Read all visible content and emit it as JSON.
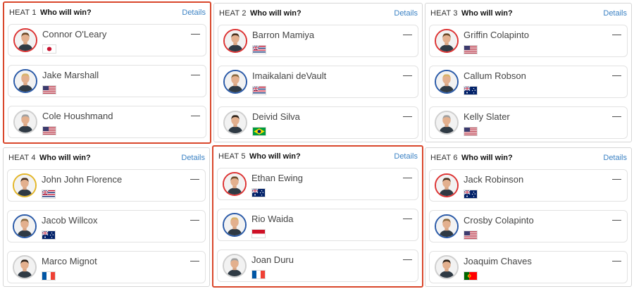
{
  "question_label": "Who will win?",
  "details_label": "Details",
  "odds_placeholder": "—",
  "heats": [
    {
      "label": "HEAT 1",
      "highlighted": true,
      "surfers": [
        {
          "name": "Connor O'Leary",
          "flag": "japan",
          "ring": "red"
        },
        {
          "name": "Jake Marshall",
          "flag": "usa",
          "ring": "blue"
        },
        {
          "name": "Cole Houshmand",
          "flag": "usa",
          "ring": "gray"
        }
      ]
    },
    {
      "label": "HEAT 2",
      "highlighted": false,
      "surfers": [
        {
          "name": "Barron Mamiya",
          "flag": "hawaii",
          "ring": "red"
        },
        {
          "name": "Imaikalani deVault",
          "flag": "hawaii",
          "ring": "blue"
        },
        {
          "name": "Deivid Silva",
          "flag": "brazil",
          "ring": "gray"
        }
      ]
    },
    {
      "label": "HEAT 3",
      "highlighted": false,
      "surfers": [
        {
          "name": "Griffin Colapinto",
          "flag": "usa",
          "ring": "red"
        },
        {
          "name": "Callum Robson",
          "flag": "australia",
          "ring": "blue"
        },
        {
          "name": "Kelly Slater",
          "flag": "usa",
          "ring": "gray"
        }
      ]
    },
    {
      "label": "HEAT 4",
      "highlighted": false,
      "surfers": [
        {
          "name": "John John Florence",
          "flag": "hawaii",
          "ring": "yellow"
        },
        {
          "name": "Jacob Willcox",
          "flag": "australia",
          "ring": "blue"
        },
        {
          "name": "Marco Mignot",
          "flag": "france",
          "ring": "gray"
        }
      ]
    },
    {
      "label": "HEAT 5",
      "highlighted": true,
      "surfers": [
        {
          "name": "Ethan Ewing",
          "flag": "australia",
          "ring": "red"
        },
        {
          "name": "Rio Waida",
          "flag": "indonesia",
          "ring": "blue"
        },
        {
          "name": "Joan Duru",
          "flag": "france",
          "ring": "gray"
        }
      ]
    },
    {
      "label": "HEAT 6",
      "highlighted": false,
      "surfers": [
        {
          "name": "Jack Robinson",
          "flag": "australia",
          "ring": "red"
        },
        {
          "name": "Crosby Colapinto",
          "flag": "usa",
          "ring": "blue"
        },
        {
          "name": "Joaquim Chaves",
          "flag": "portugal",
          "ring": "gray"
        }
      ]
    }
  ],
  "colors": {
    "highlight_border": "#d9472b",
    "details_link": "#3b82c4",
    "ring_red": "#dd3333",
    "ring_blue": "#2a5aa8",
    "ring_yellow": "#e3b629"
  }
}
